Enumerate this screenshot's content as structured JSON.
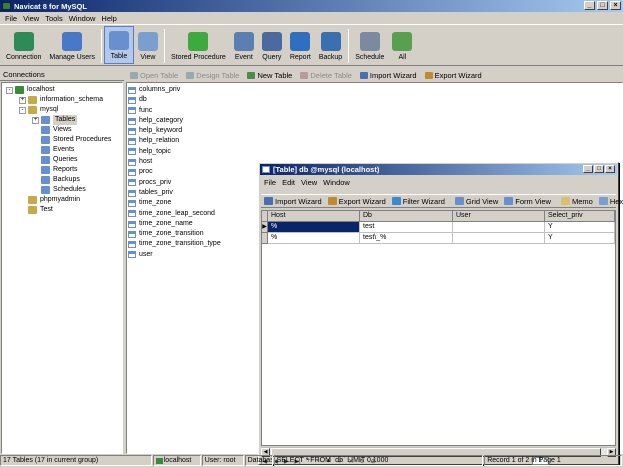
{
  "app": {
    "title": "Navicat 8 for MySQL"
  },
  "window_buttons": {
    "minimize": "_",
    "maximize": "□",
    "close": "×"
  },
  "menu": [
    {
      "label": "File"
    },
    {
      "label": "View"
    },
    {
      "label": "Tools"
    },
    {
      "label": "Window"
    },
    {
      "label": "Help"
    }
  ],
  "toolbar": [
    {
      "label": "Connection",
      "icon": "connection-icon",
      "color": "#2e8b57"
    },
    {
      "label": "Manage Users",
      "icon": "users-icon",
      "color": "#4a78c8"
    },
    {
      "label": "Table",
      "icon": "table-icon",
      "color": "#6a8fcf",
      "active": true
    },
    {
      "label": "View",
      "icon": "view-icon",
      "color": "#7a9fcf"
    },
    {
      "label": "Stored Procedure",
      "icon": "stored-procedure-icon",
      "color": "#3caa3c"
    },
    {
      "label": "Event",
      "icon": "event-icon",
      "color": "#5a7fb0"
    },
    {
      "label": "Query",
      "icon": "query-icon",
      "color": "#4a6aa0"
    },
    {
      "label": "Report",
      "icon": "report-icon",
      "color": "#2e6fbf"
    },
    {
      "label": "Backup",
      "icon": "backup-icon",
      "color": "#3a6fb0"
    },
    {
      "label": "Schedule",
      "icon": "schedule-icon",
      "color": "#7a8aa0"
    },
    {
      "label": "All",
      "icon": "all-icon",
      "color": "#58a050"
    }
  ],
  "connections": {
    "header": "Connections",
    "tree": [
      {
        "label": "localhost",
        "icon": "server-icon",
        "depth": 0,
        "expander": "-"
      },
      {
        "label": "information_schema",
        "icon": "database-icon",
        "depth": 1,
        "expander": "+"
      },
      {
        "label": "mysql",
        "icon": "database-icon",
        "depth": 1,
        "expander": "-"
      },
      {
        "label": "Tables",
        "icon": "tables-icon",
        "depth": 2,
        "expander": "+",
        "selected": true
      },
      {
        "label": "Views",
        "icon": "views-icon",
        "depth": 2
      },
      {
        "label": "Stored Procedures",
        "icon": "stored-procedures-icon",
        "depth": 2
      },
      {
        "label": "Events",
        "icon": "events-icon",
        "depth": 2
      },
      {
        "label": "Queries",
        "icon": "queries-icon",
        "depth": 2
      },
      {
        "label": "Reports",
        "icon": "reports-icon",
        "depth": 2
      },
      {
        "label": "Backups",
        "icon": "backups-icon",
        "depth": 2
      },
      {
        "label": "Schedules",
        "icon": "schedules-icon",
        "depth": 2
      },
      {
        "label": "phpmyadmin",
        "icon": "database-icon",
        "depth": 1
      },
      {
        "label": "Test",
        "icon": "database-icon",
        "depth": 1
      }
    ]
  },
  "object_toolbar": [
    {
      "label": "Open Table",
      "icon": "open-table-icon",
      "disabled": true
    },
    {
      "label": "Design Table",
      "icon": "design-table-icon",
      "disabled": true
    },
    {
      "label": "New Table",
      "icon": "new-table-icon",
      "disabled": false
    },
    {
      "label": "Delete Table",
      "icon": "delete-table-icon",
      "disabled": true
    },
    {
      "label": "Import Wizard",
      "icon": "import-wizard-icon",
      "disabled": false
    },
    {
      "label": "Export Wizard",
      "icon": "export-wizard-icon",
      "disabled": false
    }
  ],
  "tables": [
    "columns_priv",
    "db",
    "func",
    "help_category",
    "help_keyword",
    "help_relation",
    "help_topic",
    "host",
    "proc",
    "procs_priv",
    "tables_priv",
    "time_zone",
    "time_zone_leap_second",
    "time_zone_name",
    "time_zone_transition",
    "time_zone_transition_type",
    "user"
  ],
  "child": {
    "title": "[Table] db @mysql (localhost)",
    "menu": [
      {
        "label": "File"
      },
      {
        "label": "Edit"
      },
      {
        "label": "View"
      },
      {
        "label": "Window"
      }
    ],
    "toolbar": [
      {
        "label": "Import Wizard",
        "icon": "import-wizard-icon"
      },
      {
        "label": "Export Wizard",
        "icon": "export-wizard-icon"
      },
      {
        "label": "Filter Wizard",
        "icon": "filter-wizard-icon"
      },
      {
        "label": "Grid View",
        "icon": "grid-view-icon"
      },
      {
        "label": "Form View",
        "icon": "form-view-icon"
      },
      {
        "label": "Memo",
        "icon": "memo-icon"
      },
      {
        "label": "Hex",
        "icon": "hex-icon"
      }
    ],
    "columns": [
      "Host",
      "Db",
      "User",
      "Select_priv"
    ],
    "rows": [
      {
        "indicator": "▶",
        "cells": [
          "%",
          "test",
          "",
          "Y"
        ],
        "highlight_col": 0
      },
      {
        "indicator": "",
        "cells": [
          "%",
          "test\\_%",
          "",
          "Y"
        ]
      }
    ],
    "nav_buttons": [
      "|◀",
      "◀",
      "▶",
      "▶|",
      "+",
      "−",
      "▲",
      "✓",
      "✕",
      "↻",
      "⊘"
    ],
    "page_controls": {
      "page": "1"
    }
  },
  "status": {
    "tables_count": "17 Tables (17 in current group)",
    "connection": "localhost",
    "user": "User: root",
    "database": "Databas",
    "sql": "SELECT * FROM `db` LIMIT 0,1000",
    "record": "Record 1 of 2 in Page 1"
  }
}
